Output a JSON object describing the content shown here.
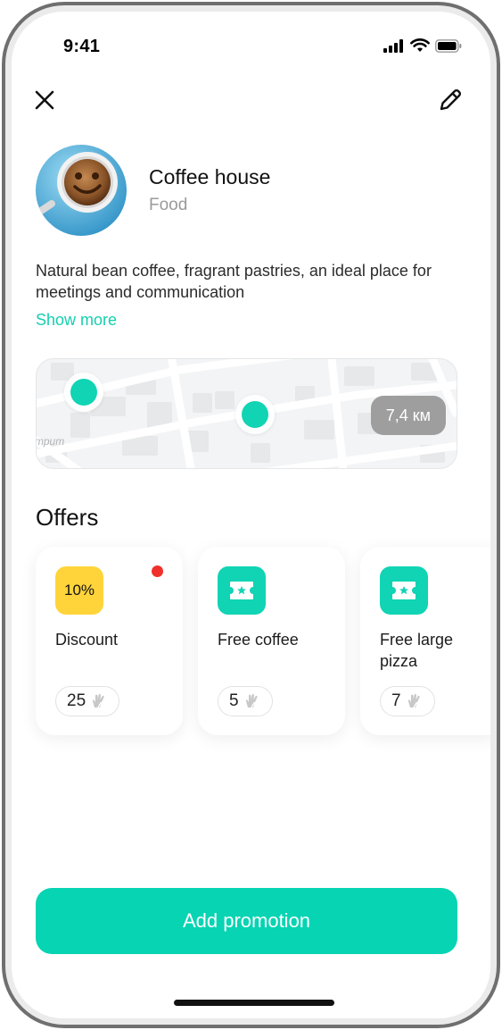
{
  "status": {
    "time": "9:41"
  },
  "business": {
    "name": "Coffee house",
    "category": "Food",
    "description": "Natural bean coffee, fragrant pastries, an ideal place for meetings and communication",
    "show_more": "Show more"
  },
  "map": {
    "distance": "7,4 км",
    "street_label": "трит"
  },
  "offers_title": "Offers",
  "offers": [
    {
      "title": "Discount",
      "icon_text": "10%",
      "icon": "percent-badge",
      "count": "25",
      "has_notification": true
    },
    {
      "title": "Free coffee",
      "icon": "ticket-star-icon",
      "count": "5"
    },
    {
      "title": "Free large pizza",
      "icon": "ticket-star-icon",
      "count": "7"
    }
  ],
  "add_button": "Add promotion",
  "colors": {
    "accent": "#06d4b3",
    "discount_badge": "#ffd43b",
    "notification": "#f0312b",
    "distance_pill": "#9e9e9e"
  }
}
